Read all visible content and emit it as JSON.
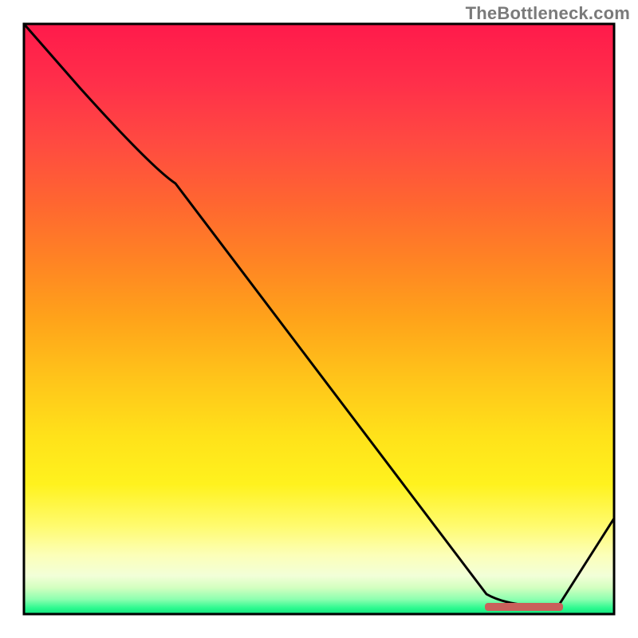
{
  "watermark": "TheBottleneck.com",
  "chart_data": {
    "type": "line",
    "title": "",
    "xlabel": "",
    "ylabel": "",
    "xlim": [
      0,
      100
    ],
    "ylim": [
      0,
      100
    ],
    "grid": false,
    "background_gradient": {
      "direction": "vertical",
      "stops": [
        {
          "pos": 0.0,
          "color": "#ff1a4b"
        },
        {
          "pos": 0.5,
          "color": "#ffa31a"
        },
        {
          "pos": 0.78,
          "color": "#fff21e"
        },
        {
          "pos": 0.95,
          "color": "#d4ffc0"
        },
        {
          "pos": 1.0,
          "color": "#11e47e"
        }
      ]
    },
    "series": [
      {
        "name": "bottleneck-curve",
        "color": "#000000",
        "x": [
          0,
          9,
          26,
          78,
          90,
          100
        ],
        "y": [
          100,
          89,
          73,
          3,
          1,
          16
        ]
      }
    ],
    "annotations": [
      {
        "name": "optimal-marker",
        "shape": "bar",
        "x_range": [
          78,
          91
        ],
        "y": 1,
        "color": "#c9605b"
      }
    ]
  }
}
